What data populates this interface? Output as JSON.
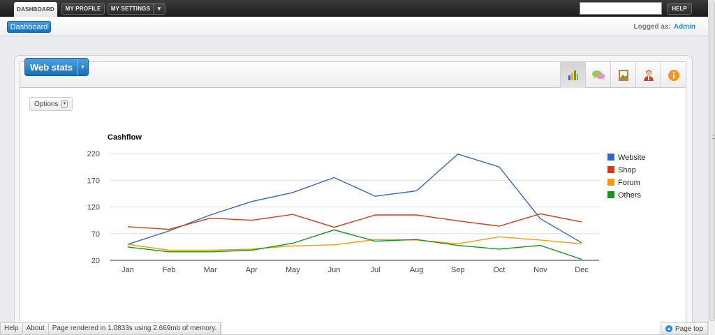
{
  "topbar": {
    "tabs": [
      {
        "label": "DASHBOARD",
        "active": true
      },
      {
        "label": "MY PROFILE"
      },
      {
        "label": "MY SETTINGS"
      }
    ],
    "search_value": "",
    "help_label": "HELP"
  },
  "subbar": {
    "dashboard_label": "Dashboard",
    "logged_label": "Logged as:",
    "user": "Admin"
  },
  "panel": {
    "title": "Web stats",
    "icons": [
      "chart-icon",
      "comments-icon",
      "picture-icon",
      "user-icon",
      "info-icon"
    ],
    "options_label": "Options"
  },
  "chart_data": {
    "type": "line",
    "title": "Cashflow",
    "x": [
      "Jan",
      "Feb",
      "Mar",
      "Apr",
      "May",
      "Jun",
      "Jul",
      "Aug",
      "Sep",
      "Oct",
      "Nov",
      "Dec"
    ],
    "ylim": [
      20,
      220
    ],
    "yticks": [
      20,
      70,
      120,
      170,
      220
    ],
    "grid": true,
    "legend": "right",
    "series": [
      {
        "name": "Website",
        "color": "#3366cc",
        "values": [
          50,
          75,
          105,
          130,
          147,
          175,
          140,
          150,
          219,
          195,
          98,
          53
        ]
      },
      {
        "name": "Shop",
        "color": "#dc3912",
        "values": [
          83,
          78,
          99,
          95,
          106,
          82,
          105,
          105,
          94,
          84,
          107,
          92
        ]
      },
      {
        "name": "Forum",
        "color": "#ff9900",
        "values": [
          50,
          39,
          39,
          41,
          47,
          49,
          59,
          58,
          51,
          64,
          58,
          51
        ]
      },
      {
        "name": "Others",
        "color": "#109618",
        "values": [
          45,
          36,
          36,
          39,
          52,
          77,
          56,
          59,
          48,
          41,
          48,
          22
        ]
      }
    ]
  },
  "footer": {
    "help": "Help",
    "about": "About",
    "render_info": "Page rendered in 1.0833s using 2.669mb of memory.",
    "page_top": "Page top"
  }
}
